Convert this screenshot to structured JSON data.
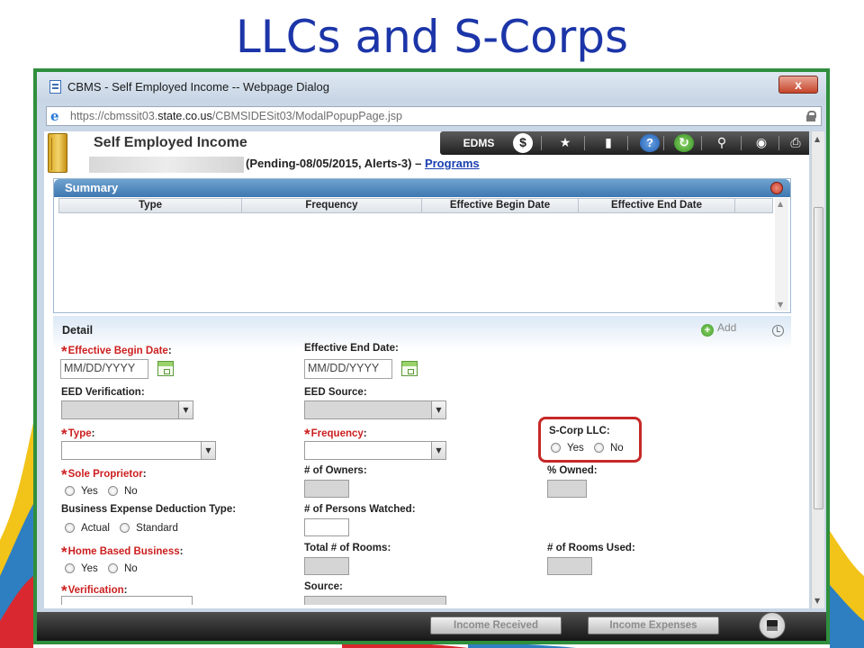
{
  "slide": {
    "title": "LLCs and S-Corps"
  },
  "window": {
    "title": "CBMS - Self Employed Income -- Webpage Dialog",
    "close_label": "x",
    "url_prefix": "https://cbmssit03.",
    "url_domain": "state.co.us",
    "url_path": "/CBMSIDESit03/ModalPopupPage.jsp"
  },
  "header": {
    "title": "Self Employed Income",
    "status": "(Pending-08/05/2015, Alerts-3) –",
    "programs_link": "Programs"
  },
  "toolbar": {
    "edms_label": "EDMS",
    "dollar_label": "$",
    "help_label": "?"
  },
  "summary": {
    "title": "Summary",
    "columns": [
      "Type",
      "Frequency",
      "Effective Begin Date",
      "Effective End Date"
    ]
  },
  "detail": {
    "title": "Detail",
    "add_label": "Add",
    "effective_begin_date": {
      "label": "Effective Begin Date",
      "value": "MM/DD/YYYY"
    },
    "effective_end_date": {
      "label": "Effective End Date",
      "value": "MM/DD/YYYY"
    },
    "eed_verification": {
      "label": "EED Verification"
    },
    "eed_source": {
      "label": "EED Source"
    },
    "type": {
      "label": "Type"
    },
    "frequency": {
      "label": "Frequency"
    },
    "scorp_llc": {
      "label": "S-Corp LLC",
      "options": [
        "Yes",
        "No"
      ]
    },
    "sole_proprietor": {
      "label": "Sole Proprietor",
      "options": [
        "Yes",
        "No"
      ]
    },
    "num_owners": {
      "label": "# of Owners"
    },
    "pct_owned": {
      "label": "% Owned"
    },
    "business_expense": {
      "label": "Business Expense Deduction Type",
      "options": [
        "Actual",
        "Standard"
      ]
    },
    "persons_watched": {
      "label": "# of Persons Watched"
    },
    "home_based": {
      "label": "Home Based Business",
      "options": [
        "Yes",
        "No"
      ]
    },
    "total_rooms": {
      "label": "Total # of Rooms"
    },
    "rooms_used": {
      "label": "# of Rooms Used"
    },
    "verification": {
      "label": "Verification"
    },
    "source": {
      "label": "Source"
    }
  },
  "footer": {
    "income_received": "Income Received",
    "income_expenses": "Income Expenses"
  },
  "colors": {
    "title_blue": "#1c35a8",
    "window_border": "#2f8f3d",
    "required_red": "#cc1f1f",
    "highlight_red": "#c62828"
  }
}
